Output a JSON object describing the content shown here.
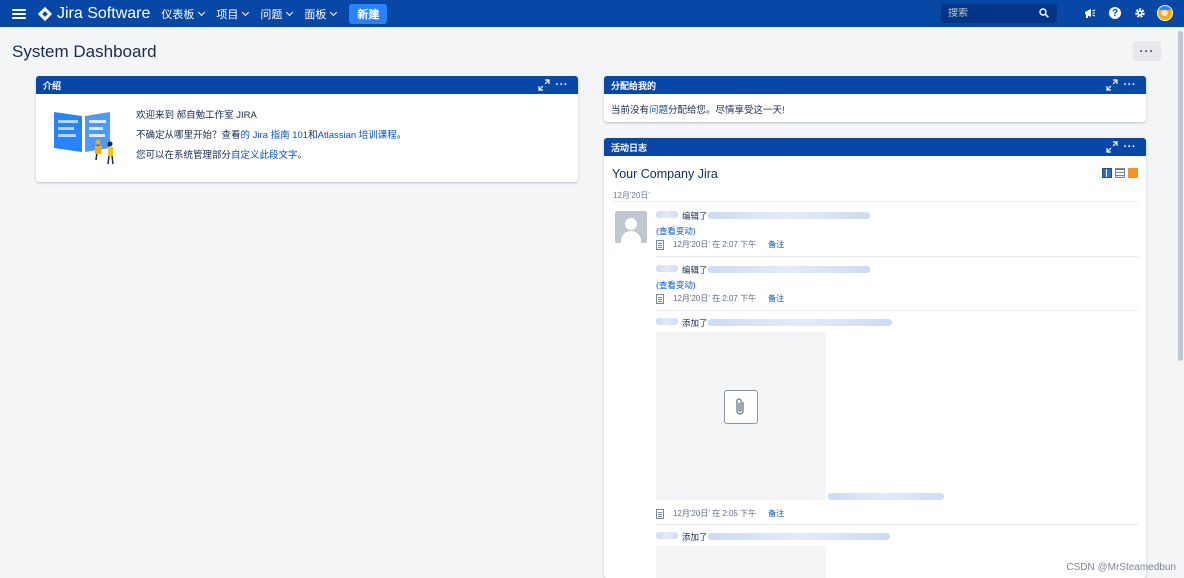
{
  "nav": {
    "logo_text": "Jira Software",
    "menu": [
      {
        "label": "仪表板"
      },
      {
        "label": "项目"
      },
      {
        "label": "问题"
      },
      {
        "label": "面板"
      }
    ],
    "create_label": "新建",
    "search_placeholder": "搜索",
    "help_glyph": "?"
  },
  "page": {
    "title": "System Dashboard",
    "more_glyph": "···"
  },
  "intro": {
    "title": "介绍",
    "line1": "欢迎来到 郝自勉工作室 JIRA",
    "line2_pre": "不确定从哪里开始？查看",
    "line2_link1": "的 Jira 指南 101",
    "line2_mid": "和",
    "line2_link2": "Atlassian 培训课程",
    "line2_post": "。",
    "line3_pre": "您可以在系统管理部分",
    "line3_link": "自定义此段文字",
    "line3_post": "。"
  },
  "assigned": {
    "title": "分配给我的",
    "text_pre": "当前没有",
    "text_link": "问题",
    "text_post": "分配给您。尽情享受这一天!"
  },
  "activity": {
    "title": "活动日志",
    "stream_title": "Your Company Jira",
    "date_header": "12月'20日'",
    "entries": [
      {
        "action": "编辑了",
        "link": "(查看变动)",
        "time": "12月'20日' 在 2:07 下午",
        "note": "备注"
      },
      {
        "action": "编辑了",
        "link": "(查看变动)",
        "time": "12月'20日' 在 2:07 下午",
        "note": "备注"
      },
      {
        "action": "添加了",
        "time": "12月'20日' 在 2:05 下午",
        "note": "备注"
      },
      {
        "action": "添加了"
      }
    ]
  },
  "tools": {
    "more_glyph": "···"
  },
  "watermark": "CSDN @MrSteamedbun",
  "colors": {
    "nav": "#0747a6",
    "gadget_header": "#0747a6",
    "create": "#2684ff",
    "link": "#0052cc"
  }
}
